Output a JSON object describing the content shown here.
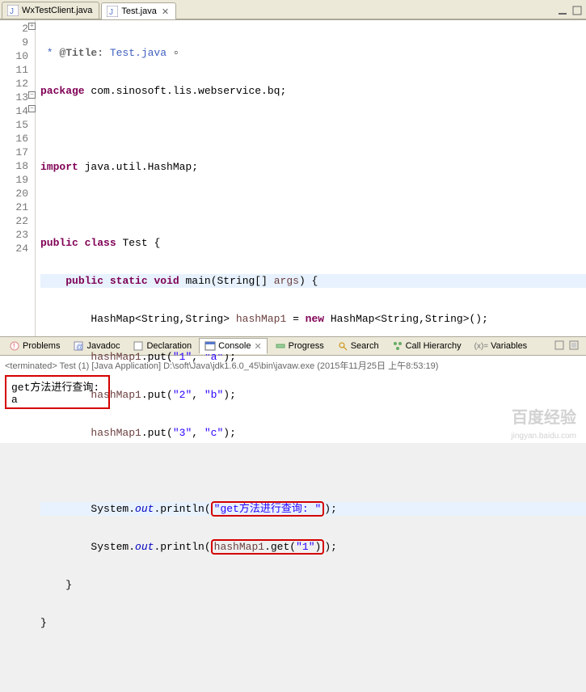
{
  "tabs": {
    "items": [
      {
        "label": "WxTestClient.java"
      },
      {
        "label": "Test.java"
      }
    ]
  },
  "code": {
    "lines": [
      "2",
      "9",
      "10",
      "11",
      "12",
      "13",
      "14",
      "15",
      "16",
      "17",
      "18",
      "19",
      "20",
      "21",
      "22",
      "23",
      "24"
    ],
    "l2_ann": "@Title:",
    "l2_rest": " Test.java",
    "l9_pkg": "package",
    "l9_rest": " com.sinosoft.lis.webservice.bq;",
    "l11_imp": "import",
    "l11_rest": " java.util.HashMap;",
    "l13_a": "public",
    "l13_b": "class",
    "l13_c": " Test {",
    "l14_a": "public",
    "l14_b": "static",
    "l14_c": "void",
    "l14_d": " main(String[] ",
    "l14_e": "args",
    "l14_f": ") {",
    "l15_a": "        HashMap<String,String> ",
    "l15_b": "hashMap1",
    "l15_c": " = ",
    "l15_d": "new",
    "l15_e": " HashMap<String,String>();",
    "l16_a": "hashMap1",
    "l16_b": ".put(",
    "l16_c": "\"1\"",
    "l16_d": ", ",
    "l16_e": "\"a\"",
    "l16_f": ");",
    "l17_a": "hashMap1",
    "l17_b": ".put(",
    "l17_c": "\"2\"",
    "l17_d": ", ",
    "l17_e": "\"b\"",
    "l17_f": ");",
    "l18_a": "hashMap1",
    "l18_b": ".put(",
    "l18_c": "\"3\"",
    "l18_d": ", ",
    "l18_e": "\"c\"",
    "l18_f": ");",
    "l20_a": "        System.",
    "l20_b": "out",
    "l20_c": ".println(",
    "l20_d": "\"get方法进行查询: \"",
    "l20_e": ");",
    "l21_a": "        System.",
    "l21_b": "out",
    "l21_c": ".println(",
    "l21_d": "hashMap1",
    "l21_e": ".get(",
    "l21_f": "\"1\"",
    "l21_g": ")",
    "l21_h": ");",
    "l22": "    }",
    "l23": "}"
  },
  "bottomTabs": {
    "problems": "Problems",
    "javadoc": "Javadoc",
    "declaration": "Declaration",
    "console": "Console",
    "progress": "Progress",
    "search": "Search",
    "callhierarchy": "Call Hierarchy",
    "variables": "Variables"
  },
  "console": {
    "terminated": "<terminated> Test (1) [Java Application] D:\\soft\\Java\\jdk1.6.0_45\\bin\\javaw.exe (2015年11月25日 上午8:53:19)",
    "out1": "get方法进行查询: ",
    "out2": "a"
  },
  "watermark": {
    "brand": "百度经验",
    "url": "jingyan.baidu.com"
  }
}
